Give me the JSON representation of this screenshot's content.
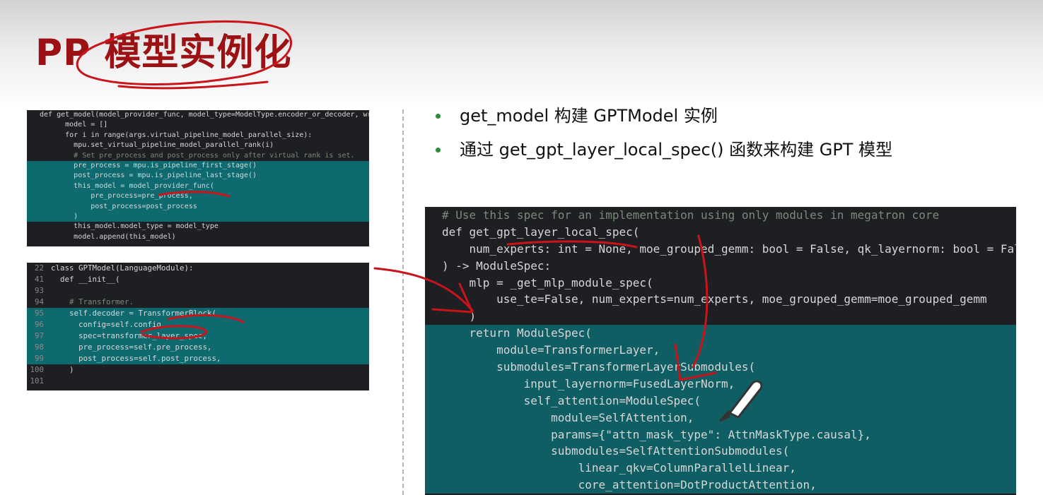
{
  "title": "PP 模型实例化",
  "bullets": [
    "get_model 构建 GPTModel 实例",
    "通过 get_gpt_layer_local_spec() 函数来构建 GPT 模型"
  ],
  "code_left_top": [
    {
      "text": "def get_model(model_provider_func, model_type=ModelType.encoder_or_decoder, wrap",
      "indent": 0,
      "hl": false
    },
    {
      "text": "model = []",
      "indent": 6,
      "hl": false
    },
    {
      "text": "for i in range(args.virtual_pipeline_model_parallel_size):",
      "indent": 6,
      "hl": false
    },
    {
      "text": "mpu.set_virtual_pipeline_model_parallel_rank(i)",
      "indent": 8,
      "hl": false
    },
    {
      "text": "# Set pre_process and post_process only after virtual rank is set.",
      "indent": 8,
      "hl": false
    },
    {
      "text": "pre_process = mpu.is_pipeline_first_stage()",
      "indent": 8,
      "hl": true
    },
    {
      "text": "post_process = mpu.is_pipeline_last_stage()",
      "indent": 8,
      "hl": true
    },
    {
      "text": "this_model = model_provider_func(",
      "indent": 8,
      "hl": true
    },
    {
      "text": "pre_process=pre_process,",
      "indent": 12,
      "hl": true
    },
    {
      "text": "post_process=post_process",
      "indent": 12,
      "hl": true
    },
    {
      "text": ")",
      "indent": 8,
      "hl": true
    },
    {
      "text": "this_model.model_type = model_type",
      "indent": 8,
      "hl": false
    },
    {
      "text": "model.append(this_model)",
      "indent": 8,
      "hl": false
    }
  ],
  "code_left_bottom": [
    {
      "num": "22",
      "text": "class GPTModel(LanguageModule):",
      "indent": 0,
      "hl": false
    },
    {
      "num": "41",
      "text": "def __init__(",
      "indent": 2,
      "hl": false
    },
    {
      "num": "93",
      "text": "",
      "indent": 0,
      "hl": false
    },
    {
      "num": "94",
      "text": "# Transformer.",
      "indent": 4,
      "hl": false
    },
    {
      "num": "95",
      "text": "self.decoder = TransformerBlock(",
      "indent": 4,
      "hl": true
    },
    {
      "num": "96",
      "text": "config=self.config,",
      "indent": 6,
      "hl": true
    },
    {
      "num": "97",
      "text": "spec=transformer_layer_spec,",
      "indent": 6,
      "hl": true
    },
    {
      "num": "98",
      "text": "pre_process=self.pre_process,",
      "indent": 6,
      "hl": true
    },
    {
      "num": "99",
      "text": "post_process=self.post_process,",
      "indent": 6,
      "hl": true
    },
    {
      "num": "100",
      "text": ")",
      "indent": 4,
      "hl": false
    },
    {
      "num": "101",
      "text": "",
      "indent": 0,
      "hl": false
    }
  ],
  "code_right": [
    {
      "text": "# Use this spec for an implementation using only modules in megatron core",
      "indent": 0,
      "hl": false
    },
    {
      "text": "def get_gpt_layer_local_spec(",
      "indent": 0,
      "hl": false
    },
    {
      "text": "num_experts: int = None, moe_grouped_gemm: bool = False, qk_layernorm: bool = Fal",
      "indent": 4,
      "hl": false
    },
    {
      "text": ") -> ModuleSpec:",
      "indent": 0,
      "hl": false
    },
    {
      "text": "mlp = _get_mlp_module_spec(",
      "indent": 4,
      "hl": false
    },
    {
      "text": "use_te=False, num_experts=num_experts, moe_grouped_gemm=moe_grouped_gemm",
      "indent": 8,
      "hl": false
    },
    {
      "text": ")",
      "indent": 4,
      "hl": false
    },
    {
      "text": "return ModuleSpec(",
      "indent": 4,
      "hl": true
    },
    {
      "text": "module=TransformerLayer,",
      "indent": 8,
      "hl": true
    },
    {
      "text": "submodules=TransformerLayerSubmodules(",
      "indent": 8,
      "hl": true
    },
    {
      "text": "input_layernorm=FusedLayerNorm,",
      "indent": 12,
      "hl": true
    },
    {
      "text": "self_attention=ModuleSpec(",
      "indent": 12,
      "hl": true
    },
    {
      "text": "module=SelfAttention,",
      "indent": 16,
      "hl": true
    },
    {
      "text": "params={\"attn_mask_type\": AttnMaskType.causal},",
      "indent": 16,
      "hl": true
    },
    {
      "text": "submodules=SelfAttentionSubmodules(",
      "indent": 16,
      "hl": true
    },
    {
      "text": "linear_qkv=ColumnParallelLinear,",
      "indent": 20,
      "hl": true
    },
    {
      "text": "core_attention=DotProductAttention,",
      "indent": 20,
      "hl": true
    }
  ],
  "colors": {
    "title": "#9c1214",
    "ink": "#c8141a",
    "highlight": "#0e6a6f",
    "code_bg": "#1e1f22",
    "bullet": "#2e8b3a"
  }
}
